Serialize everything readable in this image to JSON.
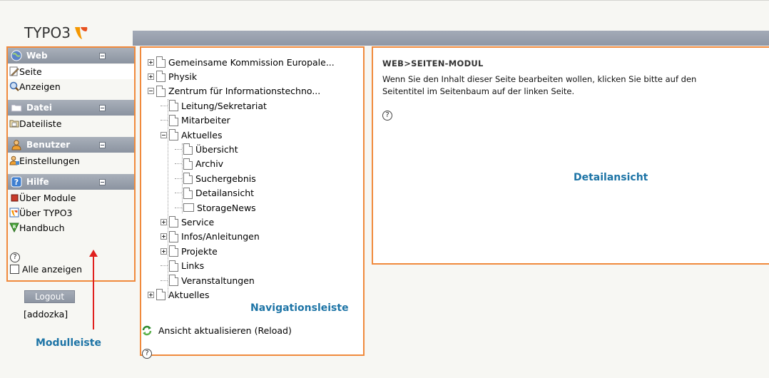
{
  "logo": {
    "text": "TYPO3"
  },
  "module_menu": {
    "groups": [
      {
        "label": "Web",
        "icon": "globe-icon",
        "items": [
          {
            "label": "Seite",
            "icon": "pencil-page-icon",
            "selected": true
          },
          {
            "label": "Anzeigen",
            "icon": "magnifier-icon"
          }
        ]
      },
      {
        "label": "Datei",
        "icon": "folder-icon",
        "items": [
          {
            "label": "Dateiliste",
            "icon": "file-list-icon"
          }
        ]
      },
      {
        "label": "Benutzer",
        "icon": "user-icon",
        "items": [
          {
            "label": "Einstellungen",
            "icon": "user-settings-icon"
          }
        ]
      },
      {
        "label": "Hilfe",
        "icon": "help-icon",
        "items": [
          {
            "label": "Über Module",
            "icon": "book-icon"
          },
          {
            "label": "Über TYPO3",
            "icon": "typo3-icon"
          },
          {
            "label": "Handbuch",
            "icon": "manual-icon"
          }
        ]
      }
    ],
    "help_glyph": "?",
    "show_all_label": "Alle anzeigen"
  },
  "logout_label": "Logout",
  "username": "[addozka]",
  "annotations": {
    "module_bar": "Modulleiste",
    "navigation_bar": "Navigationsleiste",
    "detail_view": "Detailansicht"
  },
  "page_tree": {
    "items": [
      {
        "label": "Gemeinsame Kommission Europale...",
        "toggle": "plus",
        "level": 0,
        "type": "page"
      },
      {
        "label": "Physik",
        "toggle": "plus",
        "level": 0,
        "type": "page"
      },
      {
        "label": "Zentrum für Informationstechno...",
        "toggle": "minus",
        "level": 0,
        "type": "page"
      },
      {
        "label": "Leitung/Sekretariat",
        "level": 1,
        "type": "page"
      },
      {
        "label": "Mitarbeiter",
        "level": 1,
        "type": "page"
      },
      {
        "label": "Aktuelles",
        "toggle": "minus",
        "level": 1,
        "type": "page"
      },
      {
        "label": "Übersicht",
        "level": 2,
        "type": "page"
      },
      {
        "label": "Archiv",
        "level": 2,
        "type": "page"
      },
      {
        "label": "Suchergebnis",
        "level": 2,
        "type": "page"
      },
      {
        "label": "Detailansicht",
        "level": 2,
        "type": "page"
      },
      {
        "label": "StorageNews",
        "level": 2,
        "type": "folder"
      },
      {
        "label": "Service",
        "toggle": "plus",
        "level": 1,
        "type": "page"
      },
      {
        "label": "Infos/Anleitungen",
        "toggle": "plus",
        "level": 1,
        "type": "page"
      },
      {
        "label": "Projekte",
        "toggle": "plus",
        "level": 1,
        "type": "page"
      },
      {
        "label": "Links",
        "level": 1,
        "type": "page"
      },
      {
        "label": "Veranstaltungen",
        "level": 1,
        "type": "page"
      },
      {
        "label": "Aktuelles",
        "toggle": "plus",
        "level": 0,
        "type": "page"
      }
    ],
    "reload_label": "Ansicht aktualisieren (Reload)",
    "help_glyph": "?"
  },
  "content": {
    "title": "WEB>SEITEN-MODUL",
    "line1": "Wenn Sie den Inhalt dieser Seite bearbeiten wollen, klicken Sie bitte auf den",
    "line2": "Seitentitel im Seitenbaum auf der linken Seite.",
    "help_glyph": "?"
  }
}
